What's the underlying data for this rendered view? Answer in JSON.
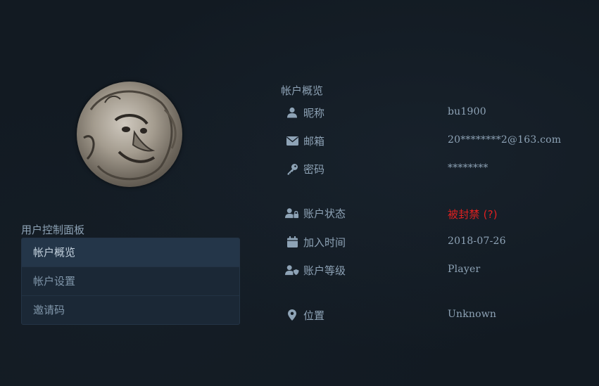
{
  "sidebar": {
    "title": "用户控制面板",
    "items": [
      {
        "label": "帐户概览",
        "active": true
      },
      {
        "label": "帐户设置",
        "active": false
      },
      {
        "label": "邀请码",
        "active": false
      }
    ]
  },
  "overview": {
    "title": "帐户概览",
    "rows": [
      {
        "icon": "user-icon",
        "label": "昵称",
        "value": "bu1900"
      },
      {
        "icon": "envelope-icon",
        "label": "邮箱",
        "value": "20********2@163.com"
      },
      {
        "icon": "key-icon",
        "label": "密码",
        "value": "********"
      },
      {
        "icon": "user-lock-icon",
        "label": "账户状态",
        "value": "被封禁 (?)"
      },
      {
        "icon": "calendar-icon",
        "label": "加入时间",
        "value": "2018-07-26"
      },
      {
        "icon": "user-shield-icon",
        "label": "账户等级",
        "value": "Player"
      },
      {
        "icon": "map-marker-icon",
        "label": "位置",
        "value": "Unknown"
      }
    ]
  },
  "colors": {
    "background": "#121a22",
    "text": "#8ea3b6",
    "danger": "#e02020",
    "menu_active": "#243649"
  }
}
